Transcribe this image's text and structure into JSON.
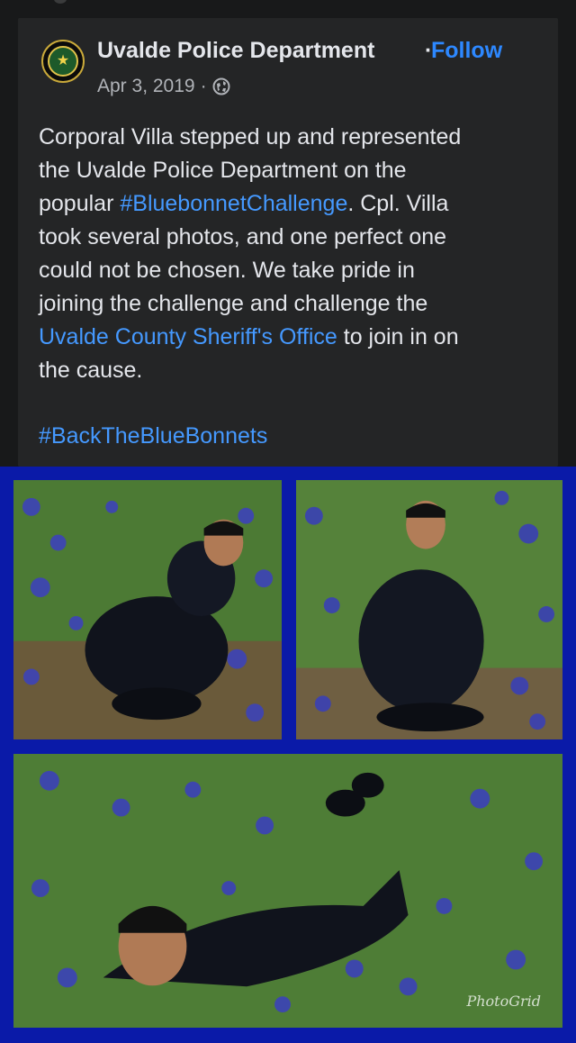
{
  "post": {
    "page_name": "Uvalde Police Department",
    "separator": "·",
    "follow_label": "Follow",
    "date": "Apr 3, 2019",
    "meta_separator": "·",
    "audience_icon": "globe-icon",
    "body": {
      "line1": "Corporal Villa stepped up and represented",
      "line2": "the Uvalde Police Department on the",
      "line3_prefix": "popular ",
      "line3_hashtag": "#BluebonnetChallenge",
      "line3_suffix": ". Cpl. Villa",
      "line4": "took several photos, and one perfect one",
      "line5": "could not be chosen. We take pride in",
      "line6": "joining the challenge and challenge the",
      "line7_mention": "Uvalde County Sheriff's Office",
      "line7_suffix": " to join in on",
      "line8": "the cause."
    },
    "footer_hashtag": "#BackTheBlueBonnets"
  },
  "collage": {
    "frame_color": "#0a1aa8",
    "photos": [
      {
        "name": "officer-seated-photo"
      },
      {
        "name": "officer-kneeling-photo"
      },
      {
        "name": "officer-lying-photo"
      }
    ],
    "watermark": "PhotoGrid"
  },
  "colors": {
    "background": "#18191a",
    "card": "#242526",
    "text": "#e4e6eb",
    "secondary_text": "#b0b3b8",
    "link": "#2d88ff"
  }
}
